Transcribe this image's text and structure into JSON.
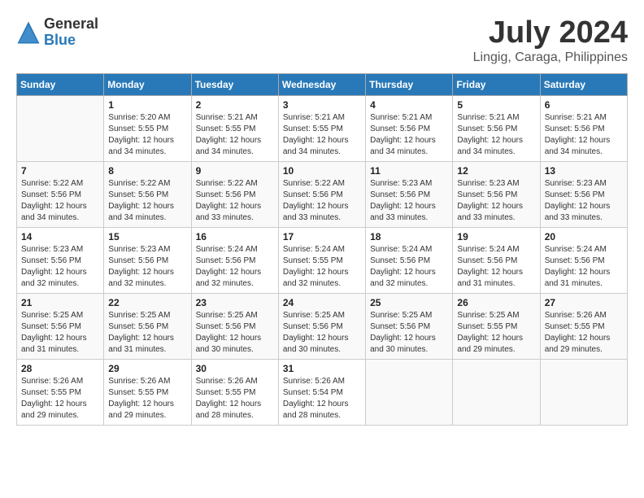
{
  "header": {
    "logo_general": "General",
    "logo_blue": "Blue",
    "month_year": "July 2024",
    "location": "Lingig, Caraga, Philippines"
  },
  "calendar": {
    "days_of_week": [
      "Sunday",
      "Monday",
      "Tuesday",
      "Wednesday",
      "Thursday",
      "Friday",
      "Saturday"
    ],
    "weeks": [
      [
        {
          "day": "",
          "sunrise": "",
          "sunset": "",
          "daylight": "",
          "empty": true
        },
        {
          "day": "1",
          "sunrise": "Sunrise: 5:20 AM",
          "sunset": "Sunset: 5:55 PM",
          "daylight": "Daylight: 12 hours and 34 minutes."
        },
        {
          "day": "2",
          "sunrise": "Sunrise: 5:21 AM",
          "sunset": "Sunset: 5:55 PM",
          "daylight": "Daylight: 12 hours and 34 minutes."
        },
        {
          "day": "3",
          "sunrise": "Sunrise: 5:21 AM",
          "sunset": "Sunset: 5:55 PM",
          "daylight": "Daylight: 12 hours and 34 minutes."
        },
        {
          "day": "4",
          "sunrise": "Sunrise: 5:21 AM",
          "sunset": "Sunset: 5:56 PM",
          "daylight": "Daylight: 12 hours and 34 minutes."
        },
        {
          "day": "5",
          "sunrise": "Sunrise: 5:21 AM",
          "sunset": "Sunset: 5:56 PM",
          "daylight": "Daylight: 12 hours and 34 minutes."
        },
        {
          "day": "6",
          "sunrise": "Sunrise: 5:21 AM",
          "sunset": "Sunset: 5:56 PM",
          "daylight": "Daylight: 12 hours and 34 minutes."
        }
      ],
      [
        {
          "day": "7",
          "sunrise": "Sunrise: 5:22 AM",
          "sunset": "Sunset: 5:56 PM",
          "daylight": "Daylight: 12 hours and 34 minutes."
        },
        {
          "day": "8",
          "sunrise": "Sunrise: 5:22 AM",
          "sunset": "Sunset: 5:56 PM",
          "daylight": "Daylight: 12 hours and 34 minutes."
        },
        {
          "day": "9",
          "sunrise": "Sunrise: 5:22 AM",
          "sunset": "Sunset: 5:56 PM",
          "daylight": "Daylight: 12 hours and 33 minutes."
        },
        {
          "day": "10",
          "sunrise": "Sunrise: 5:22 AM",
          "sunset": "Sunset: 5:56 PM",
          "daylight": "Daylight: 12 hours and 33 minutes."
        },
        {
          "day": "11",
          "sunrise": "Sunrise: 5:23 AM",
          "sunset": "Sunset: 5:56 PM",
          "daylight": "Daylight: 12 hours and 33 minutes."
        },
        {
          "day": "12",
          "sunrise": "Sunrise: 5:23 AM",
          "sunset": "Sunset: 5:56 PM",
          "daylight": "Daylight: 12 hours and 33 minutes."
        },
        {
          "day": "13",
          "sunrise": "Sunrise: 5:23 AM",
          "sunset": "Sunset: 5:56 PM",
          "daylight": "Daylight: 12 hours and 33 minutes."
        }
      ],
      [
        {
          "day": "14",
          "sunrise": "Sunrise: 5:23 AM",
          "sunset": "Sunset: 5:56 PM",
          "daylight": "Daylight: 12 hours and 32 minutes."
        },
        {
          "day": "15",
          "sunrise": "Sunrise: 5:23 AM",
          "sunset": "Sunset: 5:56 PM",
          "daylight": "Daylight: 12 hours and 32 minutes."
        },
        {
          "day": "16",
          "sunrise": "Sunrise: 5:24 AM",
          "sunset": "Sunset: 5:56 PM",
          "daylight": "Daylight: 12 hours and 32 minutes."
        },
        {
          "day": "17",
          "sunrise": "Sunrise: 5:24 AM",
          "sunset": "Sunset: 5:55 PM",
          "daylight": "Daylight: 12 hours and 32 minutes."
        },
        {
          "day": "18",
          "sunrise": "Sunrise: 5:24 AM",
          "sunset": "Sunset: 5:56 PM",
          "daylight": "Daylight: 12 hours and 32 minutes."
        },
        {
          "day": "19",
          "sunrise": "Sunrise: 5:24 AM",
          "sunset": "Sunset: 5:56 PM",
          "daylight": "Daylight: 12 hours and 31 minutes."
        },
        {
          "day": "20",
          "sunrise": "Sunrise: 5:24 AM",
          "sunset": "Sunset: 5:56 PM",
          "daylight": "Daylight: 12 hours and 31 minutes."
        }
      ],
      [
        {
          "day": "21",
          "sunrise": "Sunrise: 5:25 AM",
          "sunset": "Sunset: 5:56 PM",
          "daylight": "Daylight: 12 hours and 31 minutes."
        },
        {
          "day": "22",
          "sunrise": "Sunrise: 5:25 AM",
          "sunset": "Sunset: 5:56 PM",
          "daylight": "Daylight: 12 hours and 31 minutes."
        },
        {
          "day": "23",
          "sunrise": "Sunrise: 5:25 AM",
          "sunset": "Sunset: 5:56 PM",
          "daylight": "Daylight: 12 hours and 30 minutes."
        },
        {
          "day": "24",
          "sunrise": "Sunrise: 5:25 AM",
          "sunset": "Sunset: 5:56 PM",
          "daylight": "Daylight: 12 hours and 30 minutes."
        },
        {
          "day": "25",
          "sunrise": "Sunrise: 5:25 AM",
          "sunset": "Sunset: 5:56 PM",
          "daylight": "Daylight: 12 hours and 30 minutes."
        },
        {
          "day": "26",
          "sunrise": "Sunrise: 5:25 AM",
          "sunset": "Sunset: 5:55 PM",
          "daylight": "Daylight: 12 hours and 29 minutes."
        },
        {
          "day": "27",
          "sunrise": "Sunrise: 5:26 AM",
          "sunset": "Sunset: 5:55 PM",
          "daylight": "Daylight: 12 hours and 29 minutes."
        }
      ],
      [
        {
          "day": "28",
          "sunrise": "Sunrise: 5:26 AM",
          "sunset": "Sunset: 5:55 PM",
          "daylight": "Daylight: 12 hours and 29 minutes."
        },
        {
          "day": "29",
          "sunrise": "Sunrise: 5:26 AM",
          "sunset": "Sunset: 5:55 PM",
          "daylight": "Daylight: 12 hours and 29 minutes."
        },
        {
          "day": "30",
          "sunrise": "Sunrise: 5:26 AM",
          "sunset": "Sunset: 5:55 PM",
          "daylight": "Daylight: 12 hours and 28 minutes."
        },
        {
          "day": "31",
          "sunrise": "Sunrise: 5:26 AM",
          "sunset": "Sunset: 5:54 PM",
          "daylight": "Daylight: 12 hours and 28 minutes."
        },
        {
          "day": "",
          "sunrise": "",
          "sunset": "",
          "daylight": "",
          "empty": true
        },
        {
          "day": "",
          "sunrise": "",
          "sunset": "",
          "daylight": "",
          "empty": true
        },
        {
          "day": "",
          "sunrise": "",
          "sunset": "",
          "daylight": "",
          "empty": true
        }
      ]
    ]
  }
}
